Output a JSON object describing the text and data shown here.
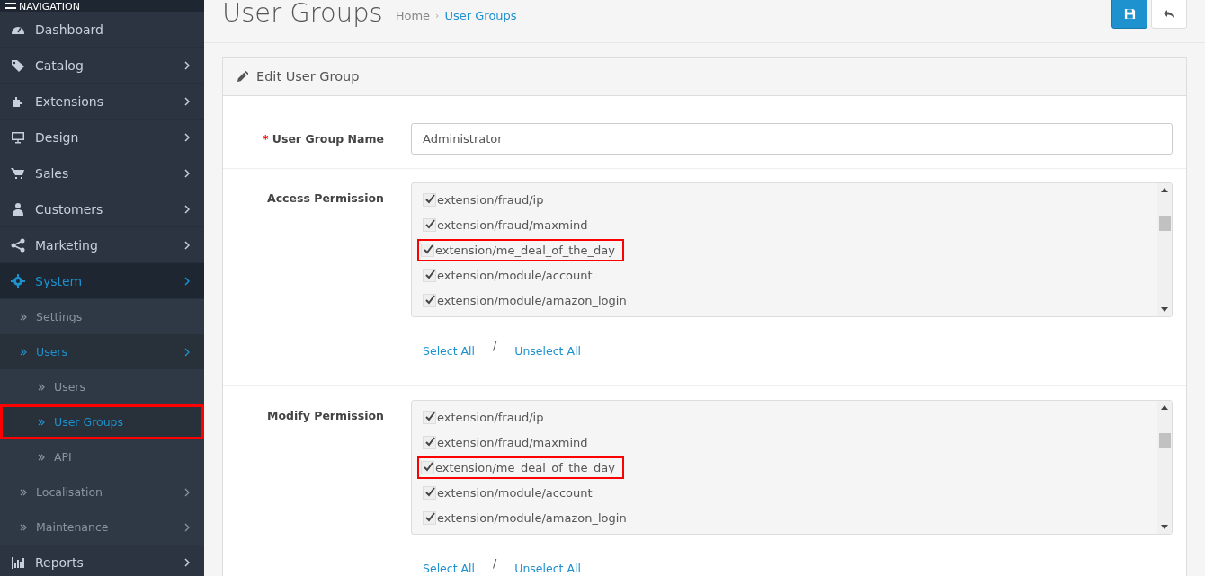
{
  "sidebar": {
    "heading": "NAVIGATION",
    "items": [
      {
        "label": "Dashboard",
        "kind": "dashboard",
        "has_arrow": false,
        "selected": false
      },
      {
        "label": "Catalog",
        "kind": "tag",
        "has_arrow": true,
        "selected": false
      },
      {
        "label": "Extensions",
        "kind": "puzzle",
        "has_arrow": true,
        "selected": false
      },
      {
        "label": "Design",
        "kind": "monitor",
        "has_arrow": true,
        "selected": false
      },
      {
        "label": "Sales",
        "kind": "cart",
        "has_arrow": true,
        "selected": false
      },
      {
        "label": "Customers",
        "kind": "user",
        "has_arrow": true,
        "selected": false
      },
      {
        "label": "Marketing",
        "kind": "share",
        "has_arrow": true,
        "selected": false
      },
      {
        "label": "System",
        "kind": "gear",
        "has_arrow": true,
        "selected": true,
        "children": [
          {
            "label": "Settings",
            "has_arrow": false,
            "selected": false,
            "highlighted": false
          },
          {
            "label": "Users",
            "has_arrow": true,
            "selected": true,
            "highlighted": false,
            "children": [
              {
                "label": "Users",
                "selected": false,
                "highlighted": false
              },
              {
                "label": "User Groups",
                "selected": true,
                "highlighted": true
              },
              {
                "label": "API",
                "selected": false,
                "highlighted": false
              }
            ]
          },
          {
            "label": "Localisation",
            "has_arrow": true,
            "selected": false,
            "highlighted": false
          },
          {
            "label": "Maintenance",
            "has_arrow": true,
            "selected": false,
            "highlighted": false
          }
        ]
      },
      {
        "label": "Reports",
        "kind": "chart",
        "has_arrow": true,
        "selected": false
      }
    ]
  },
  "page": {
    "title": "User Groups",
    "breadcrumb_separator": "›",
    "breadcrumb": [
      {
        "label": "Home",
        "selected": false
      },
      {
        "label": "User Groups",
        "selected": true
      }
    ]
  },
  "panel": {
    "title": "Edit User Group",
    "name_field": {
      "label": "User Group Name",
      "required_mark": "*",
      "value": "Administrator"
    },
    "permissions": [
      {
        "label": "Access Permission",
        "items": [
          {
            "label": "extension/fraud/ip",
            "checked": true,
            "highlighted": false
          },
          {
            "label": "extension/fraud/maxmind",
            "checked": true,
            "highlighted": false
          },
          {
            "label": "extension/me_deal_of_the_day",
            "checked": true,
            "highlighted": true
          },
          {
            "label": "extension/module/account",
            "checked": true,
            "highlighted": false
          },
          {
            "label": "extension/module/amazon_login",
            "checked": true,
            "highlighted": false
          }
        ],
        "select_all": "Select All",
        "separator": "/",
        "unselect_all": "Unselect All"
      },
      {
        "label": "Modify Permission",
        "items": [
          {
            "label": "extension/fraud/ip",
            "checked": true,
            "highlighted": false
          },
          {
            "label": "extension/fraud/maxmind",
            "checked": true,
            "highlighted": false
          },
          {
            "label": "extension/me_deal_of_the_day",
            "checked": true,
            "highlighted": true
          },
          {
            "label": "extension/module/account",
            "checked": true,
            "highlighted": false
          },
          {
            "label": "extension/module/amazon_login",
            "checked": true,
            "highlighted": false
          }
        ],
        "select_all": "Select All",
        "separator": "/",
        "unselect_all": "Unselect All"
      }
    ]
  }
}
